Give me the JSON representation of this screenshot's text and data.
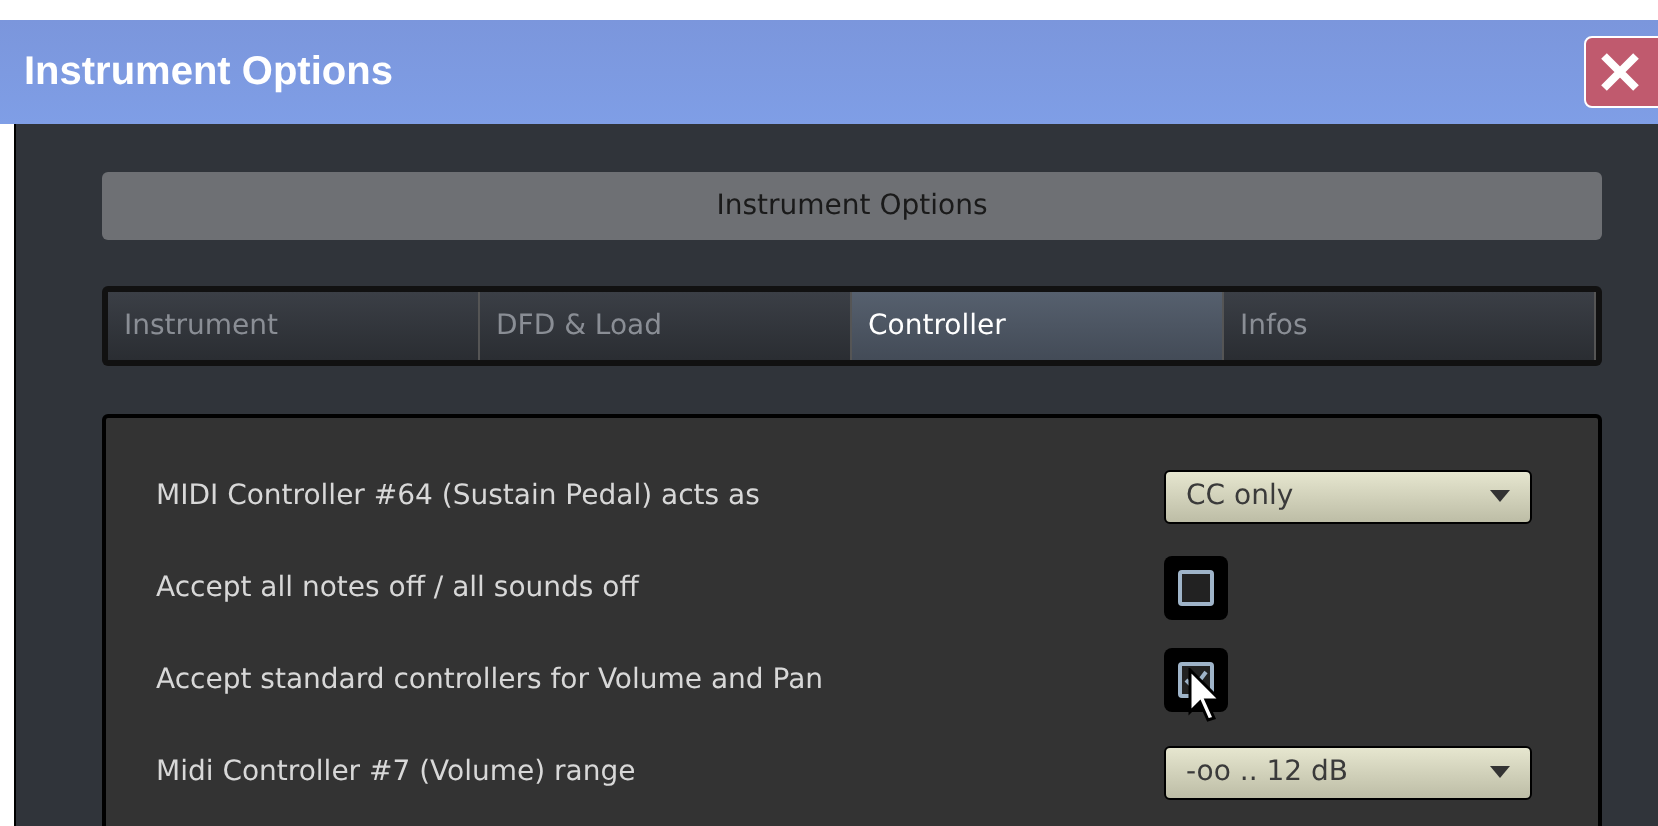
{
  "window": {
    "title": "Instrument Options"
  },
  "header": "Instrument Options",
  "tabs": [
    {
      "label": "Instrument",
      "selected": false
    },
    {
      "label": "DFD & Load",
      "selected": false
    },
    {
      "label": "Controller",
      "selected": true
    },
    {
      "label": "Infos",
      "selected": false
    }
  ],
  "settings": [
    {
      "label": "MIDI Controller #64 (Sustain Pedal) acts as",
      "kind": "dropdown",
      "value": "CC only"
    },
    {
      "label": "Accept all notes off / all sounds off",
      "kind": "checkbox",
      "checked": false
    },
    {
      "label": "Accept standard controllers for Volume and Pan",
      "kind": "checkbox",
      "checked": true
    },
    {
      "label": "Midi Controller #7 (Volume) range",
      "kind": "dropdown",
      "value": "-oo .. 12 dB"
    }
  ]
}
